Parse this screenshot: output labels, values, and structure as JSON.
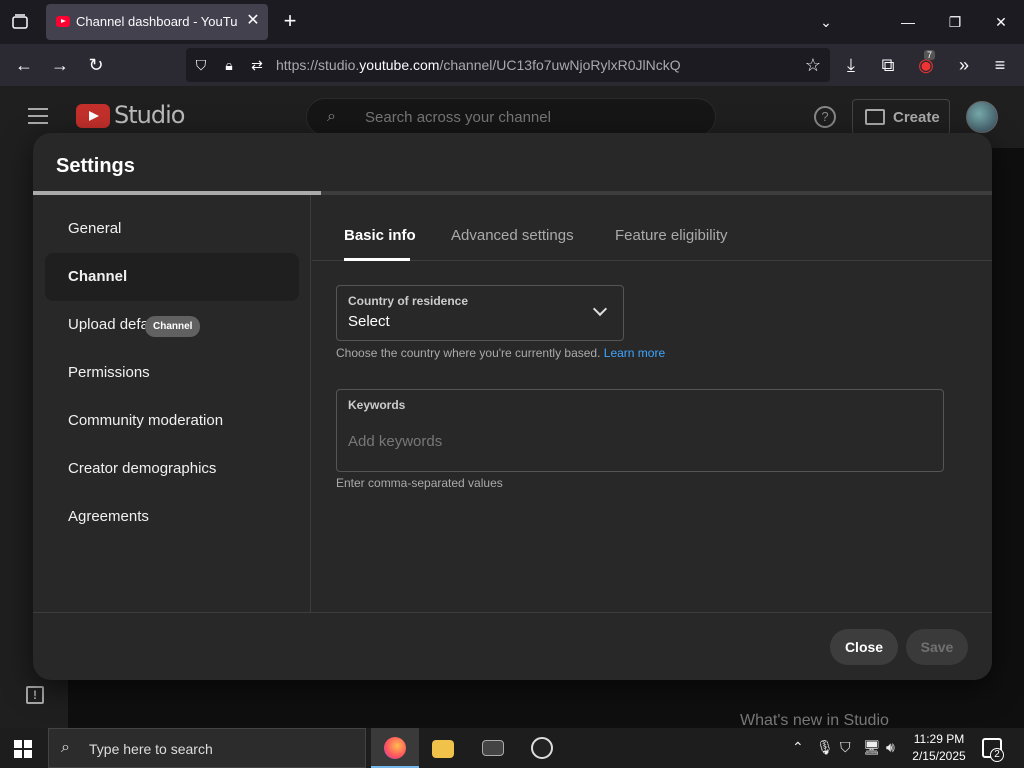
{
  "browser": {
    "tab_title": "Channel dashboard - YouTube Studio",
    "url_prefix": "https://studio.",
    "url_domain": "youtube.com",
    "url_path": "/channel/UC13fo7uwNjoRylxR0JlNckQ",
    "extension_badge": "7"
  },
  "studio": {
    "logo_text": "Studio",
    "search_placeholder": "Search across your channel",
    "create_label": "Create",
    "whats_new": "What's new in Studio"
  },
  "settings": {
    "title": "Settings",
    "progress_fraction": 0.3,
    "nav": [
      {
        "label": "General"
      },
      {
        "label": "Channel"
      },
      {
        "label": "Upload defaults"
      },
      {
        "label": "Permissions"
      },
      {
        "label": "Community moderation"
      },
      {
        "label": "Creator demographics"
      },
      {
        "label": "Agreements"
      }
    ],
    "tooltip": "Channel",
    "tabs": [
      {
        "label": "Basic info"
      },
      {
        "label": "Advanced settings"
      },
      {
        "label": "Feature eligibility"
      }
    ],
    "country": {
      "label": "Country of residence",
      "value": "Select",
      "helper": "Choose the country where you're currently based.",
      "learn_more": "Learn more"
    },
    "keywords": {
      "label": "Keywords",
      "placeholder": "Add keywords",
      "value": "",
      "helper": "Enter comma-separated values"
    },
    "close_label": "Close",
    "save_label": "Save"
  },
  "taskbar": {
    "search_placeholder": "Type here to search",
    "time": "11:29 PM",
    "date": "2/15/2025",
    "notification_count": "2"
  }
}
